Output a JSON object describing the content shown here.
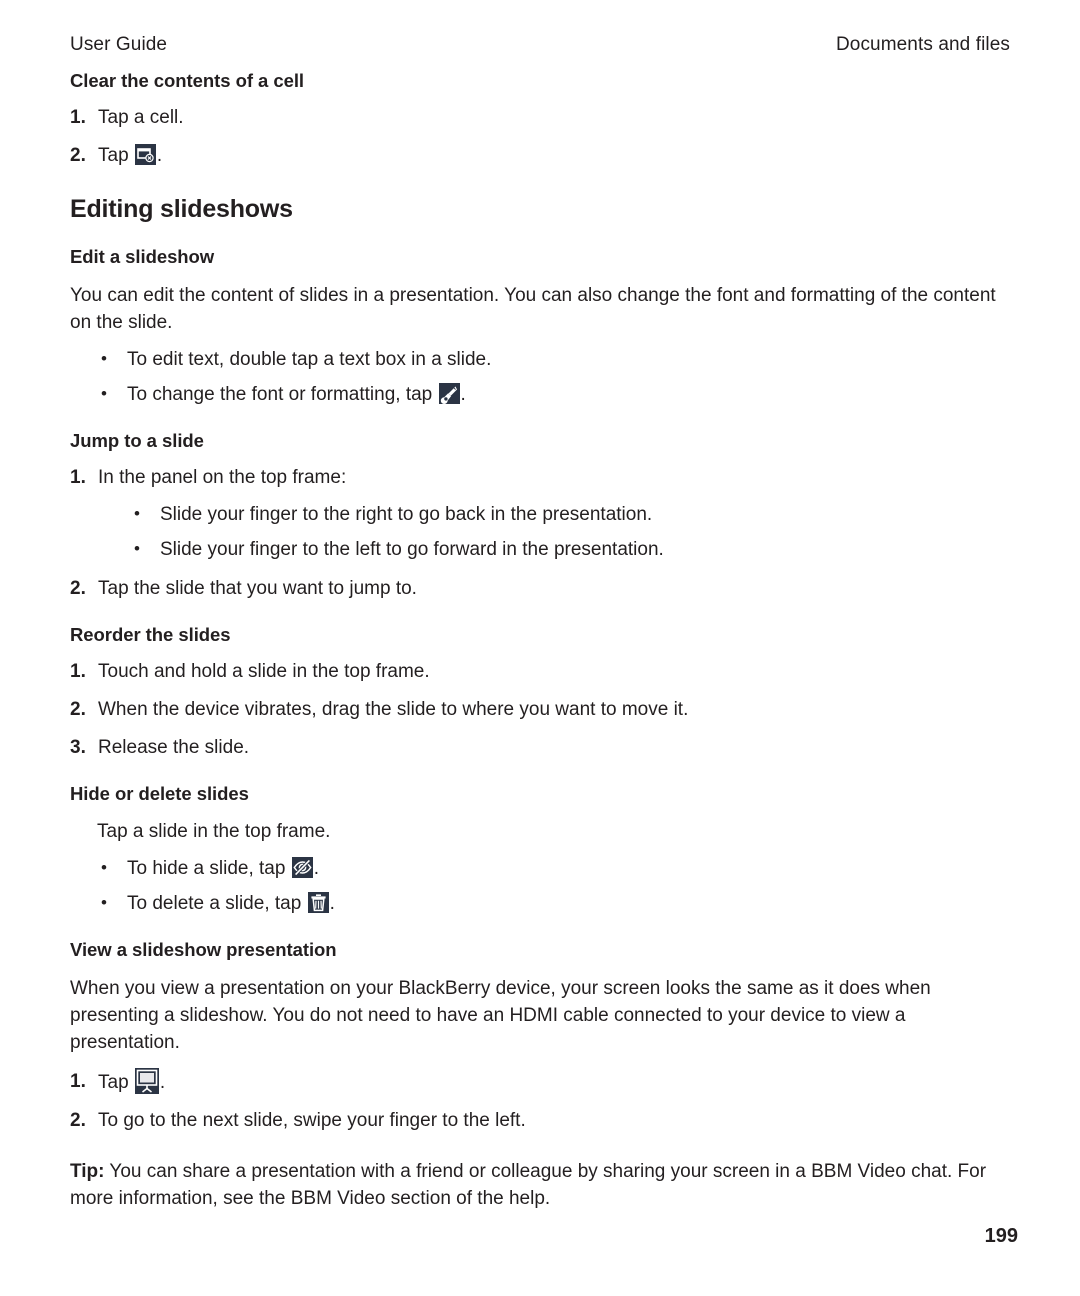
{
  "header": {
    "left": "User Guide",
    "right": "Documents and files"
  },
  "sections": {
    "clear_cell": {
      "title": "Clear the contents of a cell",
      "steps": [
        {
          "num": "1.",
          "text": "Tap a cell."
        },
        {
          "num": "2.",
          "pre": "Tap ",
          "icon": "clear-cell-icon",
          "post": "."
        }
      ]
    },
    "editing_slideshows": {
      "title": "Editing slideshows"
    },
    "edit_slideshow": {
      "title": "Edit a slideshow",
      "paragraph": "You can edit the content of slides in a presentation. You can also change the font and formatting of the content on the slide.",
      "bullets": [
        {
          "text": "To edit text, double tap a text box in a slide."
        },
        {
          "pre": "To change the font or formatting, tap ",
          "icon": "pen-nib-icon",
          "post": "."
        }
      ]
    },
    "jump_to_slide": {
      "title": "Jump to a slide",
      "step1": {
        "num": "1.",
        "text": "In the panel on the top frame:"
      },
      "nested_bullets": [
        "Slide your finger to the right to go back in the presentation.",
        "Slide your finger to the left to go forward in the presentation."
      ],
      "step2": {
        "num": "2.",
        "text": "Tap the slide that you want to jump to."
      }
    },
    "reorder_slides": {
      "title": "Reorder the slides",
      "steps": [
        {
          "num": "1.",
          "text": "Touch and hold a slide in the top frame."
        },
        {
          "num": "2.",
          "text": "When the device vibrates, drag the slide to where you want to move it."
        },
        {
          "num": "3.",
          "text": "Release the slide."
        }
      ]
    },
    "hide_delete_slides": {
      "title": "Hide or delete slides",
      "lead": "Tap a slide in the top frame.",
      "bullets": [
        {
          "pre": "To hide a slide, tap ",
          "icon": "eye-slash-icon",
          "post": "."
        },
        {
          "pre": "To delete a slide, tap ",
          "icon": "trash-icon",
          "post": "."
        }
      ]
    },
    "view_slideshow": {
      "title": "View a slideshow presentation",
      "paragraph": "When you view a presentation on your BlackBerry device, your screen looks the same as it does when presenting a slideshow. You do not need to have an HDMI cable connected to your device to view a presentation.",
      "steps": [
        {
          "num": "1.",
          "pre": "Tap ",
          "icon": "presentation-screen-icon",
          "post": "."
        },
        {
          "num": "2.",
          "text": "To go to the next slide, swipe your finger to the left."
        }
      ],
      "tip_label": "Tip:",
      "tip_text": " You can share a presentation with a friend or colleague by sharing your screen in a BBM Video chat. For more information, see the BBM Video section of the help."
    }
  },
  "footer": {
    "page_number": "199"
  },
  "colors": {
    "text": "#231f20",
    "icon_background": "#2b3444",
    "icon_foreground": "#ffffff"
  }
}
